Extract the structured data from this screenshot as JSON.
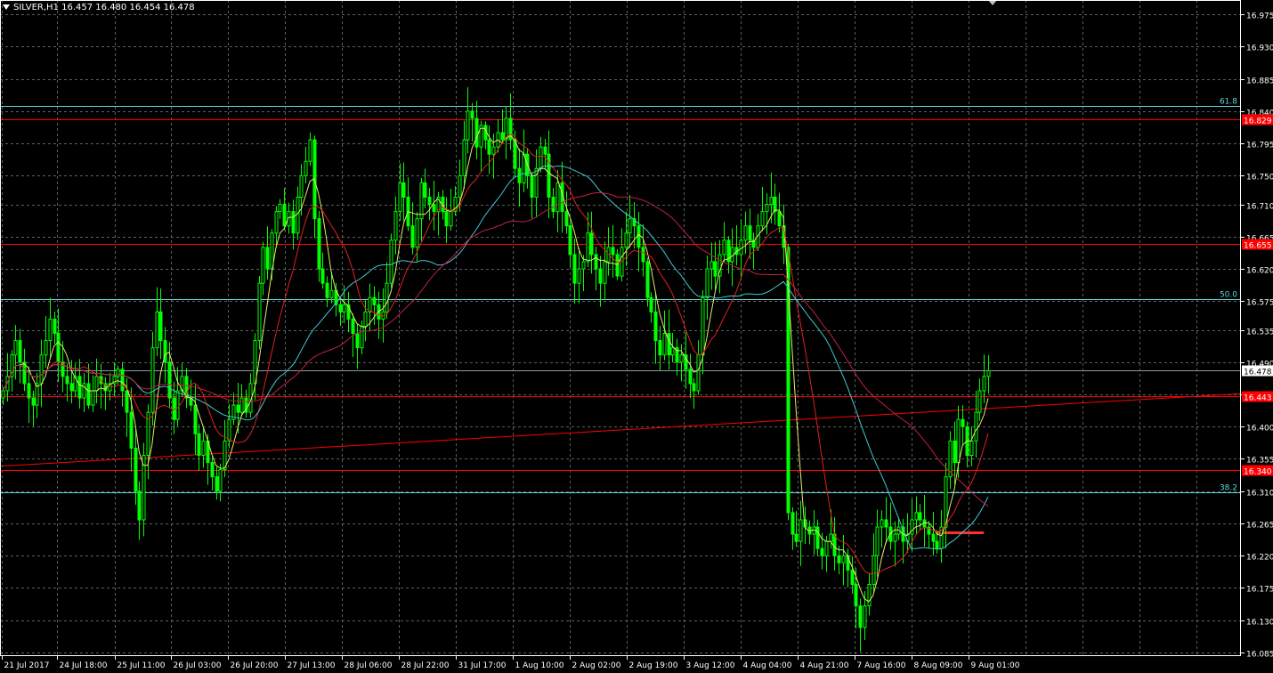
{
  "chart_data": {
    "type": "candlestick",
    "symbol_header": "SILVER,H1  16.457 16.480 16.454 16.478",
    "header_parts": {
      "symbol": "SILVER,H1",
      "ohlc": "16.457 16.480 16.454 16.478"
    },
    "ylim": [
      16.08,
      16.995
    ],
    "y_ticks": [
      "16.975",
      "16.930",
      "16.885",
      "16.840",
      "16.795",
      "16.750",
      "16.710",
      "16.665",
      "16.620",
      "16.575",
      "16.535",
      "16.490",
      "16.445",
      "16.400",
      "16.355",
      "16.310",
      "16.265",
      "16.220",
      "16.175",
      "16.130",
      "16.085"
    ],
    "x_ticks": [
      "21 Jul 2017",
      "24 Jul 18:00",
      "25 Jul 11:00",
      "26 Jul 03:00",
      "26 Jul 20:00",
      "27 Jul 13:00",
      "28 Jul 06:00",
      "28 Jul 22:00",
      "31 Jul 17:00",
      "1 Aug 10:00",
      "2 Aug 02:00",
      "2 Aug 19:00",
      "3 Aug 12:00",
      "4 Aug 04:00",
      "4 Aug 21:00",
      "7 Aug 16:00",
      "8 Aug 09:00",
      "9 Aug 01:00"
    ],
    "horizontal_levels": [
      {
        "price": 16.829,
        "label": "16.829",
        "color": "#ff0000"
      },
      {
        "price": 16.655,
        "label": "16.655",
        "color": "#ff0000"
      },
      {
        "price": 16.443,
        "label": "16.443",
        "color": "#ff0000"
      },
      {
        "price": 16.34,
        "label": "16.340",
        "color": "#ff0000"
      }
    ],
    "fibo_levels": [
      {
        "price": 16.847,
        "label": "61.8",
        "color": "#5fd7d7"
      },
      {
        "price": 16.578,
        "label": "50.0",
        "color": "#5fd7d7"
      },
      {
        "price": 16.308,
        "label": "38.2",
        "color": "#5fd7d7"
      }
    ],
    "current_price": {
      "price": 16.478,
      "label": "16.478"
    },
    "trendline": {
      "from": {
        "bar": 0,
        "price": 16.345
      },
      "to": {
        "bar": 234,
        "price": 16.446
      },
      "color": "#ff0000"
    },
    "marker_segment": {
      "from": {
        "bar": 219,
        "price": 16.252
      },
      "to": {
        "bar": 230,
        "price": 16.252
      },
      "color": "#ff3030"
    },
    "close_series": [
      16.45,
      16.47,
      16.5,
      16.52,
      16.49,
      16.46,
      16.44,
      16.43,
      16.46,
      16.5,
      16.52,
      16.55,
      16.53,
      16.49,
      16.47,
      16.46,
      16.45,
      16.47,
      16.44,
      16.46,
      16.43,
      16.45,
      16.47,
      16.46,
      16.45,
      16.46,
      16.47,
      16.48,
      16.45,
      16.42,
      16.37,
      16.31,
      16.27,
      16.36,
      16.42,
      16.51,
      16.56,
      16.52,
      16.49,
      16.44,
      16.41,
      16.45,
      16.47,
      16.44,
      16.43,
      16.39,
      16.36,
      16.38,
      16.35,
      16.33,
      16.31,
      16.34,
      16.38,
      16.41,
      16.43,
      16.42,
      16.44,
      16.42,
      16.46,
      16.52,
      16.6,
      16.65,
      16.62,
      16.67,
      16.7,
      16.71,
      16.68,
      16.7,
      16.67,
      16.72,
      16.75,
      16.77,
      16.8,
      16.69,
      16.62,
      16.6,
      16.58,
      16.59,
      16.57,
      16.56,
      16.57,
      16.55,
      16.53,
      16.51,
      16.54,
      16.56,
      16.58,
      16.57,
      16.55,
      16.56,
      16.6,
      16.66,
      16.7,
      16.74,
      16.72,
      16.68,
      16.65,
      16.69,
      16.74,
      16.72,
      16.71,
      16.7,
      16.72,
      16.7,
      16.68,
      16.7,
      16.72,
      16.75,
      16.8,
      16.84,
      16.83,
      16.79,
      16.82,
      16.8,
      16.78,
      16.79,
      16.81,
      16.8,
      16.83,
      16.8,
      16.76,
      16.74,
      16.78,
      16.75,
      16.72,
      16.76,
      16.79,
      16.78,
      16.72,
      16.7,
      16.74,
      16.7,
      16.68,
      16.64,
      16.6,
      16.62,
      16.63,
      16.67,
      16.64,
      16.62,
      16.6,
      16.63,
      16.65,
      16.64,
      16.61,
      16.65,
      16.67,
      16.69,
      16.68,
      16.65,
      16.63,
      16.58,
      16.56,
      16.52,
      16.5,
      16.53,
      16.5,
      16.51,
      16.49,
      16.5,
      16.48,
      16.46,
      16.45,
      16.5,
      16.58,
      16.62,
      16.63,
      16.61,
      16.64,
      16.66,
      16.63,
      16.65,
      16.64,
      16.66,
      16.68,
      16.66,
      16.65,
      16.68,
      16.7,
      16.71,
      16.72,
      16.7,
      16.68,
      16.65,
      16.28,
      16.25,
      16.24,
      16.27,
      16.26,
      16.25,
      16.26,
      16.23,
      16.22,
      16.24,
      16.25,
      16.22,
      16.21,
      16.22,
      16.2,
      16.18,
      16.15,
      16.12,
      16.15,
      16.18,
      16.22,
      16.26,
      16.27,
      16.26,
      16.24,
      16.25,
      16.26,
      16.24,
      16.25,
      16.27,
      16.28,
      16.27,
      16.26,
      16.25,
      16.24,
      16.23,
      16.26,
      16.33,
      16.38,
      16.35,
      16.41,
      16.4,
      16.36,
      16.38,
      16.42,
      16.45,
      16.47,
      16.478
    ],
    "ma_lines": [
      {
        "name": "MA fast",
        "color": "#e8e870"
      },
      {
        "name": "MA medium",
        "color": "#e02020"
      },
      {
        "name": "MA slow",
        "color": "#40c8d0"
      },
      {
        "name": "MA long",
        "color": "#c02040"
      }
    ],
    "colors": {
      "background": "#000000",
      "grid": "#888888",
      "bull": "#00ff00",
      "bear": "#00ff00",
      "axis_text": "#ffffff",
      "frame": "#ffffff"
    },
    "grid": true
  }
}
